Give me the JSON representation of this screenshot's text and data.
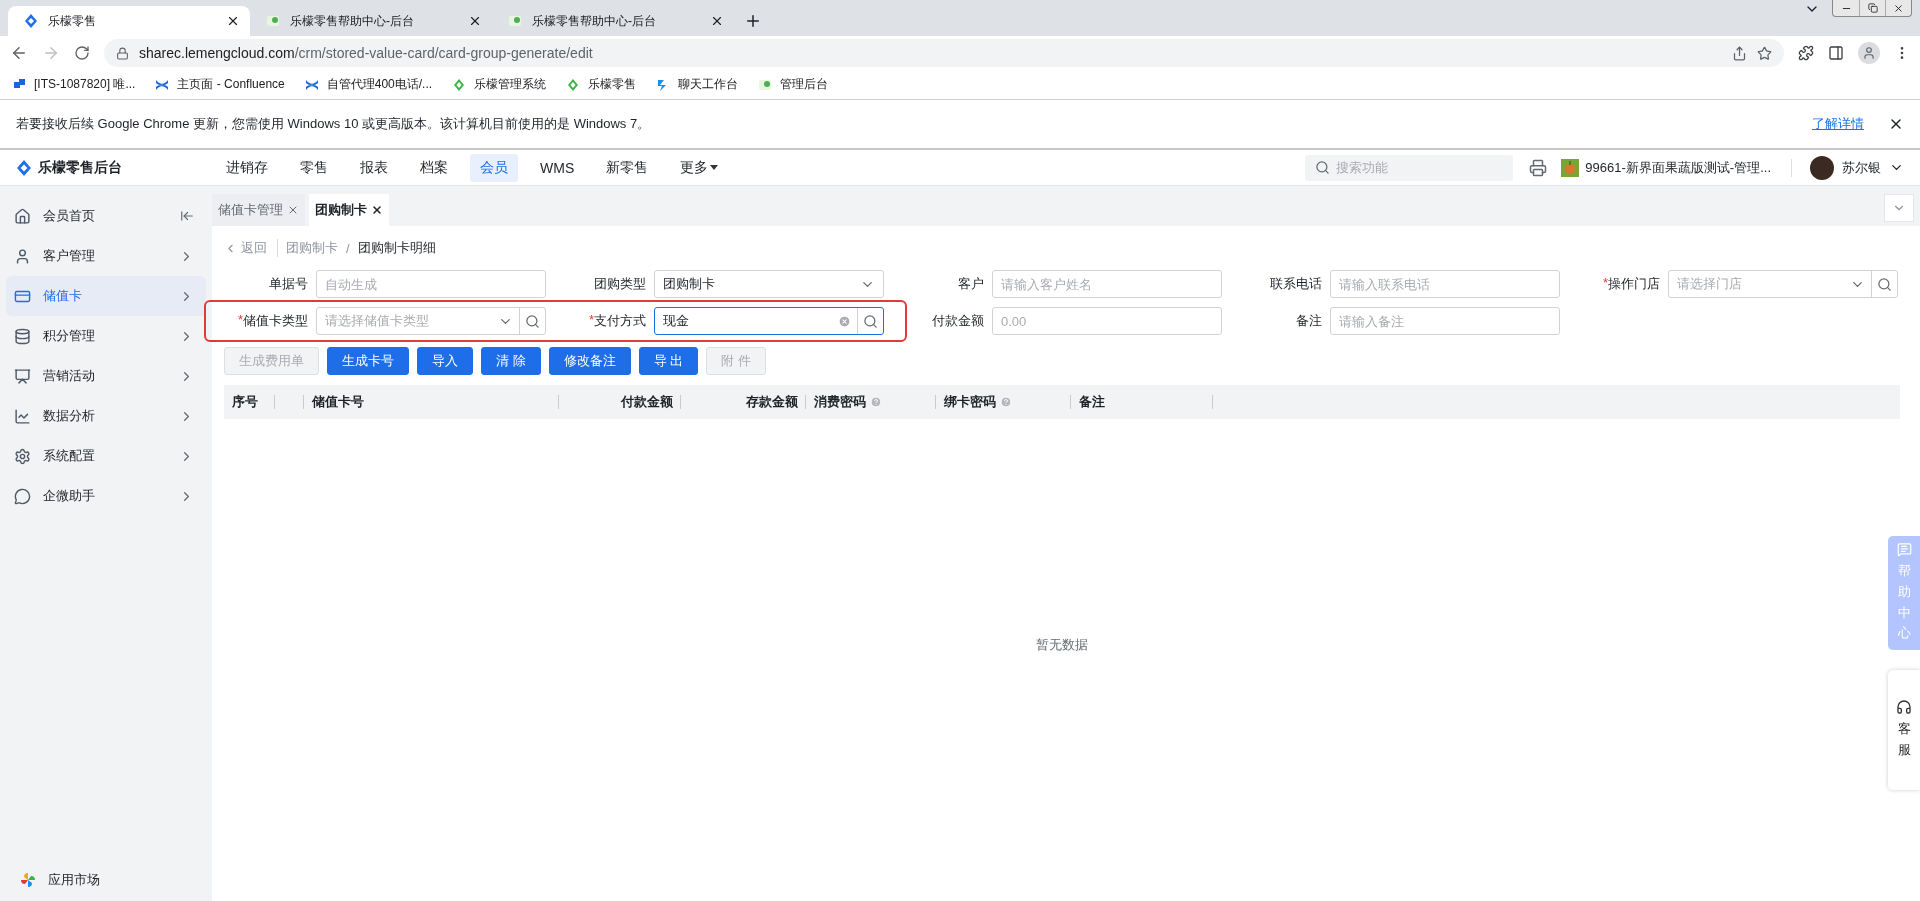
{
  "browser": {
    "tabs": [
      {
        "title": "乐檬零售",
        "selected": true
      },
      {
        "title": "乐檬零售帮助中心-后台",
        "selected": false
      },
      {
        "title": "乐檬零售帮助中心-后台",
        "selected": false
      }
    ],
    "url": {
      "host": "sharec.lemengcloud.com",
      "path": "/crm/stored-value-card/card-group-generate/edit"
    },
    "bookmarks": [
      {
        "label": "[ITS-1087820] 唯..."
      },
      {
        "label": "主页面 - Confluence"
      },
      {
        "label": "自管代理400电话/..."
      },
      {
        "label": "乐檬管理系统"
      },
      {
        "label": "乐檬零售"
      },
      {
        "label": "聊天工作台"
      },
      {
        "label": "管理后台"
      }
    ],
    "infobar": {
      "message": "若要接收后续 Google Chrome 更新，您需使用 Windows 10 或更高版本。该计算机目前使用的是 Windows 7。",
      "link": "了解详情"
    }
  },
  "app": {
    "brand": "乐檬零售后台",
    "nav": [
      {
        "label": "进销存",
        "selected": false
      },
      {
        "label": "零售",
        "selected": false
      },
      {
        "label": "报表",
        "selected": false
      },
      {
        "label": "档案",
        "selected": false
      },
      {
        "label": "会员",
        "selected": true
      },
      {
        "label": "WMS",
        "selected": false
      },
      {
        "label": "新零售",
        "selected": false
      },
      {
        "label": "更多",
        "selected": false
      }
    ],
    "search": {
      "placeholder": "搜索功能"
    },
    "store": "99661-新界面果蔬版测试-管理...",
    "user": "苏尔银"
  },
  "sidebar": {
    "items": [
      {
        "label": "会员首页",
        "selected": false
      },
      {
        "label": "客户管理",
        "selected": false
      },
      {
        "label": "储值卡",
        "selected": true
      },
      {
        "label": "积分管理",
        "selected": false
      },
      {
        "label": "营销活动",
        "selected": false
      },
      {
        "label": "数据分析",
        "selected": false
      },
      {
        "label": "系统配置",
        "selected": false
      },
      {
        "label": "企微助手",
        "selected": false
      }
    ],
    "footer": "应用市场"
  },
  "page_tabs": [
    {
      "label": "储值卡管理",
      "selected": false
    },
    {
      "label": "团购制卡",
      "selected": true
    }
  ],
  "breadcrumb": {
    "back": "返回",
    "separator": "/",
    "items": [
      "团购制卡",
      "团购制卡明细"
    ]
  },
  "form": {
    "rows": [
      [
        {
          "label": "单据号",
          "kind": "text",
          "placeholder": "自动生成",
          "focused": false
        },
        {
          "label": "团购类型",
          "kind": "select",
          "value": "团购制卡",
          "focused": false
        },
        {
          "label": "客户",
          "kind": "text",
          "placeholder": "请输入客户姓名",
          "focused": false
        },
        {
          "label": "联系电话",
          "kind": "text",
          "placeholder": "请输入联系电话",
          "focused": false
        },
        {
          "label": "操作门店",
          "required_mark": "*",
          "kind": "select-search",
          "placeholder": "请选择门店",
          "focused": false
        }
      ],
      [
        {
          "label": "储值卡类型",
          "required_mark": "*",
          "kind": "select-search",
          "placeholder": "请选择储值卡类型",
          "focused": false
        },
        {
          "label": "支付方式",
          "required_mark": "*",
          "kind": "clear-search",
          "value": "现金",
          "focused": true
        },
        {
          "label": "付款金额",
          "kind": "text",
          "placeholder": "0.00",
          "focused": false
        },
        {
          "label": "备注",
          "kind": "text",
          "placeholder": "请输入备注",
          "focused": false
        }
      ]
    ],
    "annotations": [
      {
        "kind": "frame"
      }
    ]
  },
  "buttons": [
    {
      "label": "生成费用单",
      "disabled": true
    },
    {
      "label": "生成卡号",
      "disabled": false
    },
    {
      "label": "导入",
      "disabled": false
    },
    {
      "label": "清 除",
      "disabled": false
    },
    {
      "label": "修改备注",
      "disabled": false
    },
    {
      "label": "导 出",
      "disabled": false
    },
    {
      "label": "附 件",
      "disabled": true
    }
  ],
  "table": {
    "columns": [
      {
        "label": "序号",
        "help": false
      },
      {
        "label": "储值卡号",
        "help": false
      },
      {
        "label": "付款金额",
        "help": false
      },
      {
        "label": "存款金额",
        "help": false
      },
      {
        "label": "消费密码",
        "help": true
      },
      {
        "label": "绑卡密码",
        "help": true
      },
      {
        "label": "备注",
        "help": false
      }
    ],
    "empty_text": "暂无数据"
  },
  "side_widgets": {
    "help": "帮助中心",
    "service": "客服"
  }
}
